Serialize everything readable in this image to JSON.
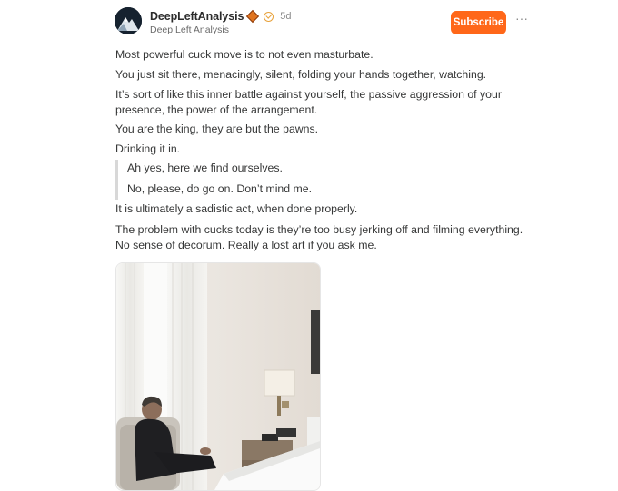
{
  "author": {
    "name": "DeepLeftAnalysis",
    "time": "5d",
    "publication": "Deep Left Analysis"
  },
  "actions": {
    "subscribe_label": "Subscribe",
    "more_label": "···"
  },
  "post": {
    "paragraphs": [
      "Most powerful cuck move is to not even masturbate.",
      "You just sit there, menacingly, silent, folding your hands together, watching.",
      "It’s sort of like this inner battle against yourself, the passive aggression of your presence, the power of the arrangement.",
      "You are the king, they are but the pawns.",
      "Drinking it in."
    ],
    "quote": [
      "Ah yes, here we find ourselves.",
      "No, please, do go on. Don’t mind me."
    ],
    "after_quote": [
      "It is ultimately a sadistic act, when done properly.",
      "The problem with cucks today is they’re too busy jerking off and filming everything. No sense of decorum. Really a lost art if you ask me."
    ]
  },
  "colors": {
    "accent": "#ff6719",
    "text": "#363737",
    "muted": "#8a8a8a"
  },
  "icons": {
    "badge": "orange-diamond-badge-icon",
    "verified": "verified-check-icon",
    "more": "more-dots-icon"
  }
}
